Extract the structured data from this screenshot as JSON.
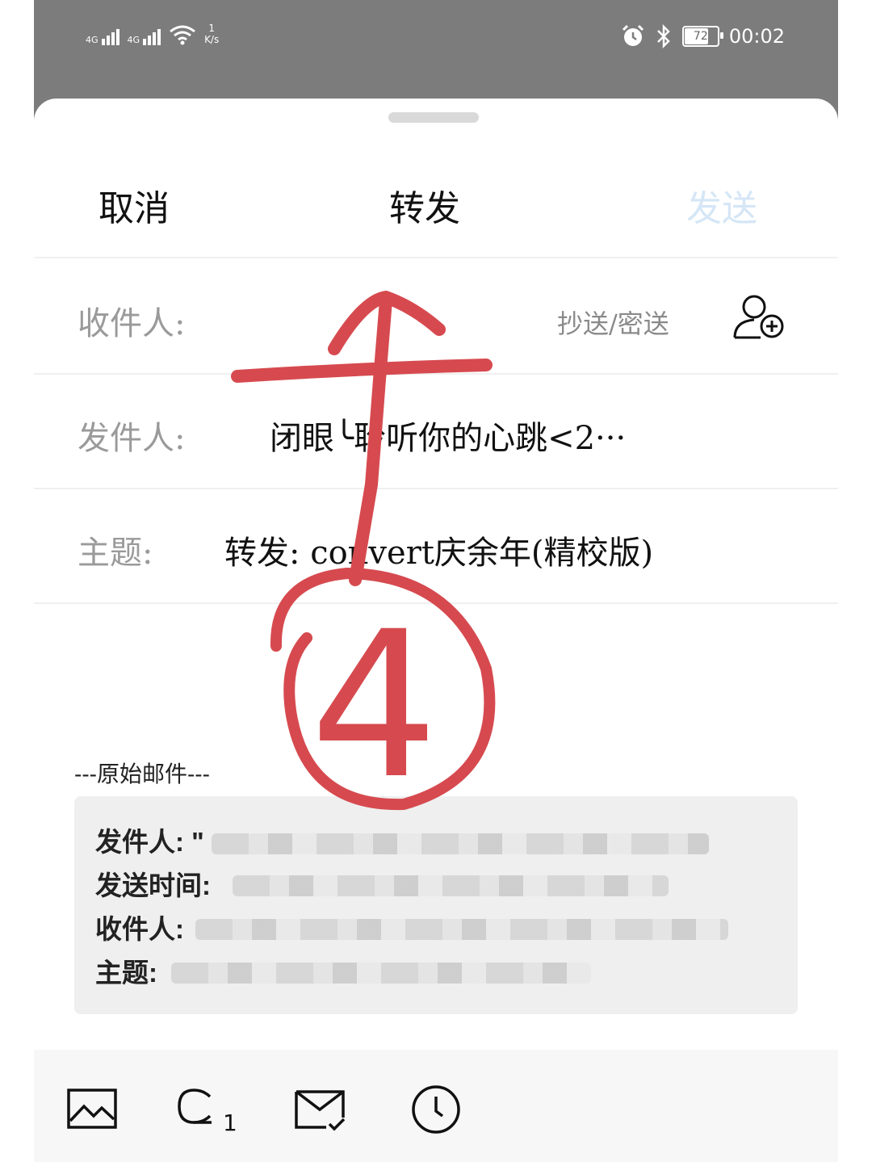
{
  "status_bar": {
    "signal1_label": "4G",
    "signal2_label": "4G",
    "speed_value": "1",
    "speed_unit": "K/s",
    "battery": "72",
    "time": "00:02"
  },
  "header": {
    "cancel_label": "取消",
    "title": "转发",
    "send_label": "发送"
  },
  "fields": {
    "to_label": "收件人:",
    "cc_bcc_label": "抄送/密送",
    "from_label": "发件人:",
    "from_value": "闭眼╰聆听你的心跳<2···",
    "subject_label": "主题:",
    "subject_value": "转发: convert庆余年(精校版)"
  },
  "original": {
    "divider_label": "---原始邮件---",
    "from_label": "发件人: \"",
    "sent_time_label": "发送时间:",
    "to_label": "收件人:",
    "subject_label": "主题:"
  },
  "toolbar": {
    "icons": [
      "image-icon",
      "attachment-icon",
      "mail-check-icon",
      "clock-icon"
    ],
    "attachment_count": "1"
  },
  "annotation": {
    "number": "4",
    "color": "#d64a4f"
  }
}
